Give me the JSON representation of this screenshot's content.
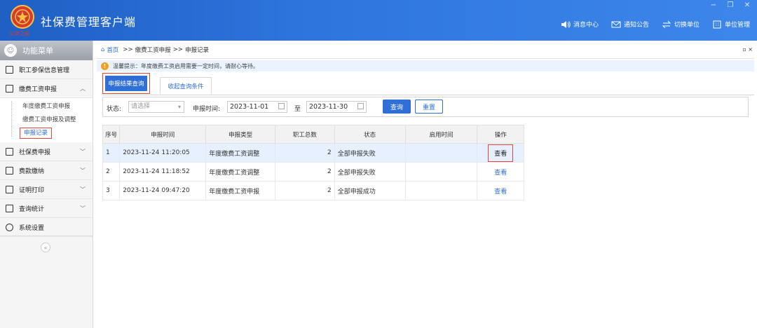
{
  "app": {
    "title": "社保费管理客户端",
    "logo_text": "公务之窗"
  },
  "window_controls": [
    "−",
    "❐",
    "✕"
  ],
  "top_nav": [
    {
      "label": "消息中心",
      "icon": "speaker-icon"
    },
    {
      "label": "通知公告",
      "icon": "mail-icon"
    },
    {
      "label": "切换单位",
      "icon": "switch-icon"
    },
    {
      "label": "单位管理",
      "icon": "building-icon"
    }
  ],
  "sidebar": {
    "header": "功能菜单",
    "items": [
      {
        "label": "职工参保信息管理"
      },
      {
        "label": "缴费工资申报",
        "expanded": true,
        "children": [
          {
            "label": "年度缴费工资申报"
          },
          {
            "label": "缴费工资申报及调整"
          },
          {
            "label": "申报记录",
            "active": true
          }
        ]
      },
      {
        "label": "社保费申报"
      },
      {
        "label": "费款缴纳"
      },
      {
        "label": "证明打印"
      },
      {
        "label": "查询统计"
      },
      {
        "label": "系统设置"
      }
    ],
    "collapse": "«"
  },
  "breadcrumb": {
    "home": "首页",
    "sep": ">>",
    "level1": "缴费工资申报",
    "level2": "申报记录"
  },
  "close": "▫ ×",
  "notice": {
    "icon": "!",
    "text": "温馨提示：年度缴费工资启用需要一定时间，请耐心等待。"
  },
  "tabs": {
    "active": "申报结果查询",
    "other": "收起查询条件"
  },
  "filter": {
    "status_label": "状态:",
    "status_placeholder": "请选择",
    "date_label": "申报时间:",
    "date_from": "2023-11-01",
    "to_label": "至",
    "date_to": "2023-11-30",
    "query": "查询",
    "reset": "重置"
  },
  "table": {
    "columns": [
      "序号",
      "申报时间",
      "申报类型",
      "职工总数",
      "状态",
      "启用时间",
      "操作"
    ],
    "rows": [
      {
        "no": "1",
        "time": "2023-11-24 11:20:05",
        "type": "年度缴费工资调整",
        "count": "2",
        "status": "全部申报失败",
        "enable": "",
        "op": "查看"
      },
      {
        "no": "2",
        "time": "2023-11-24 11:18:52",
        "type": "年度缴费工资调整",
        "count": "2",
        "status": "全部申报失败",
        "enable": "",
        "op": "查看"
      },
      {
        "no": "3",
        "time": "2023-11-24 09:47:20",
        "type": "年度缴费工资申报",
        "count": "2",
        "status": "全部申报成功",
        "enable": "",
        "op": "查看"
      }
    ]
  }
}
